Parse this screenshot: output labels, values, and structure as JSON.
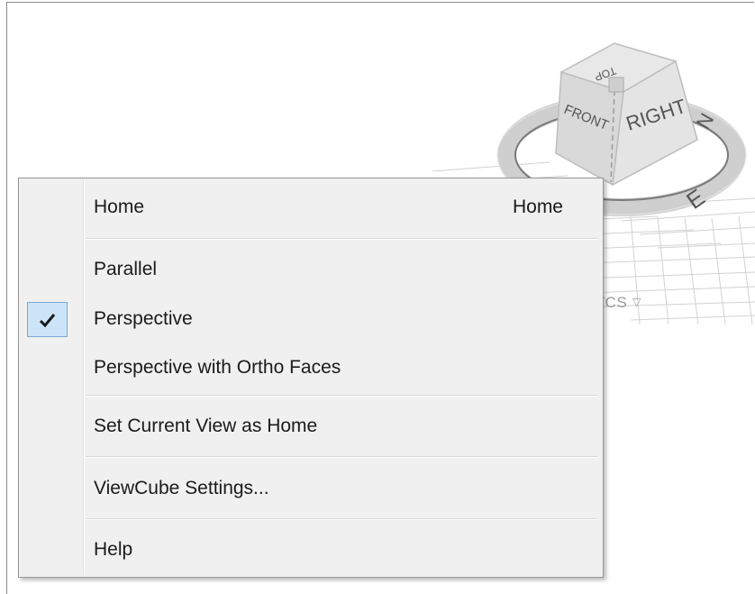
{
  "viewcube": {
    "faces": {
      "front": "FRONT",
      "right": "RIGHT",
      "top": "TOP"
    },
    "compass": {
      "east": "E",
      "north": "N"
    },
    "wcs_label": "WCS",
    "wcs_dropdown_icon": "triangle-down-icon"
  },
  "context_menu": {
    "items": [
      {
        "label": "Home",
        "shortcut": "Home",
        "checked": false
      },
      {
        "label": "Parallel",
        "checked": false
      },
      {
        "label": "Perspective",
        "checked": true
      },
      {
        "label": "Perspective with Ortho Faces",
        "checked": false
      },
      {
        "label": "Set Current View as Home",
        "checked": false
      },
      {
        "label": "ViewCube Settings...",
        "checked": false
      },
      {
        "label": "Help",
        "checked": false
      }
    ],
    "check_icon": "checkmark-icon",
    "check_highlight_color": "#cce4f7"
  }
}
